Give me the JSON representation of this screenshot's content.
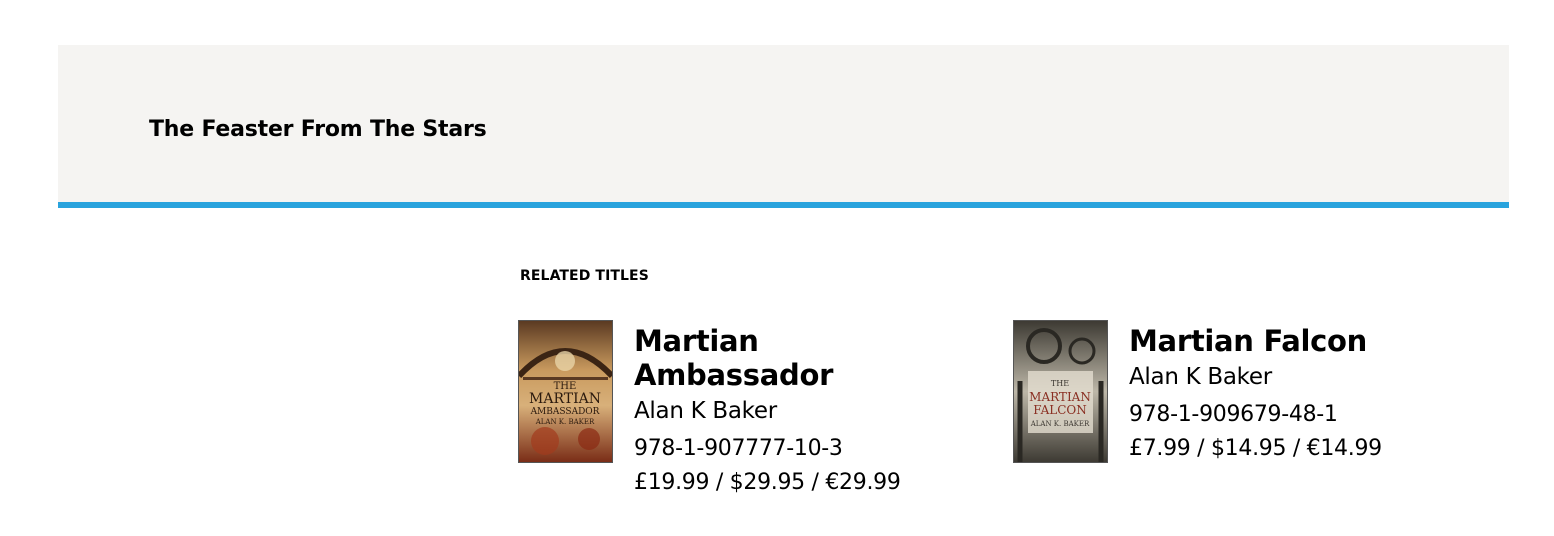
{
  "banner": {
    "title": "The Feaster From The Stars"
  },
  "related": {
    "heading": "RELATED TITLES",
    "books": [
      {
        "title": "Martian Ambassador",
        "author": "Alan K Baker",
        "isbn": "978-1-907777-10-3",
        "price": "£19.99 / $29.95 / €29.99",
        "cover_text": {
          "title_line1": "THE",
          "title_line2": "MARTIAN",
          "title_line3": "AMBASSADOR",
          "author": "ALAN K. BAKER"
        }
      },
      {
        "title": "Martian Falcon",
        "author": "Alan K Baker",
        "isbn": "978-1-909679-48-1",
        "price": "£7.99 / $14.95 / €14.99",
        "cover_text": {
          "title_line1": "THE",
          "title_line2": "MARTIAN",
          "title_line3": "FALCON",
          "author": "ALAN K. BAKER"
        }
      }
    ]
  },
  "colors": {
    "banner_bg": "#f5f4f2",
    "accent_rule": "#29a3dd"
  }
}
